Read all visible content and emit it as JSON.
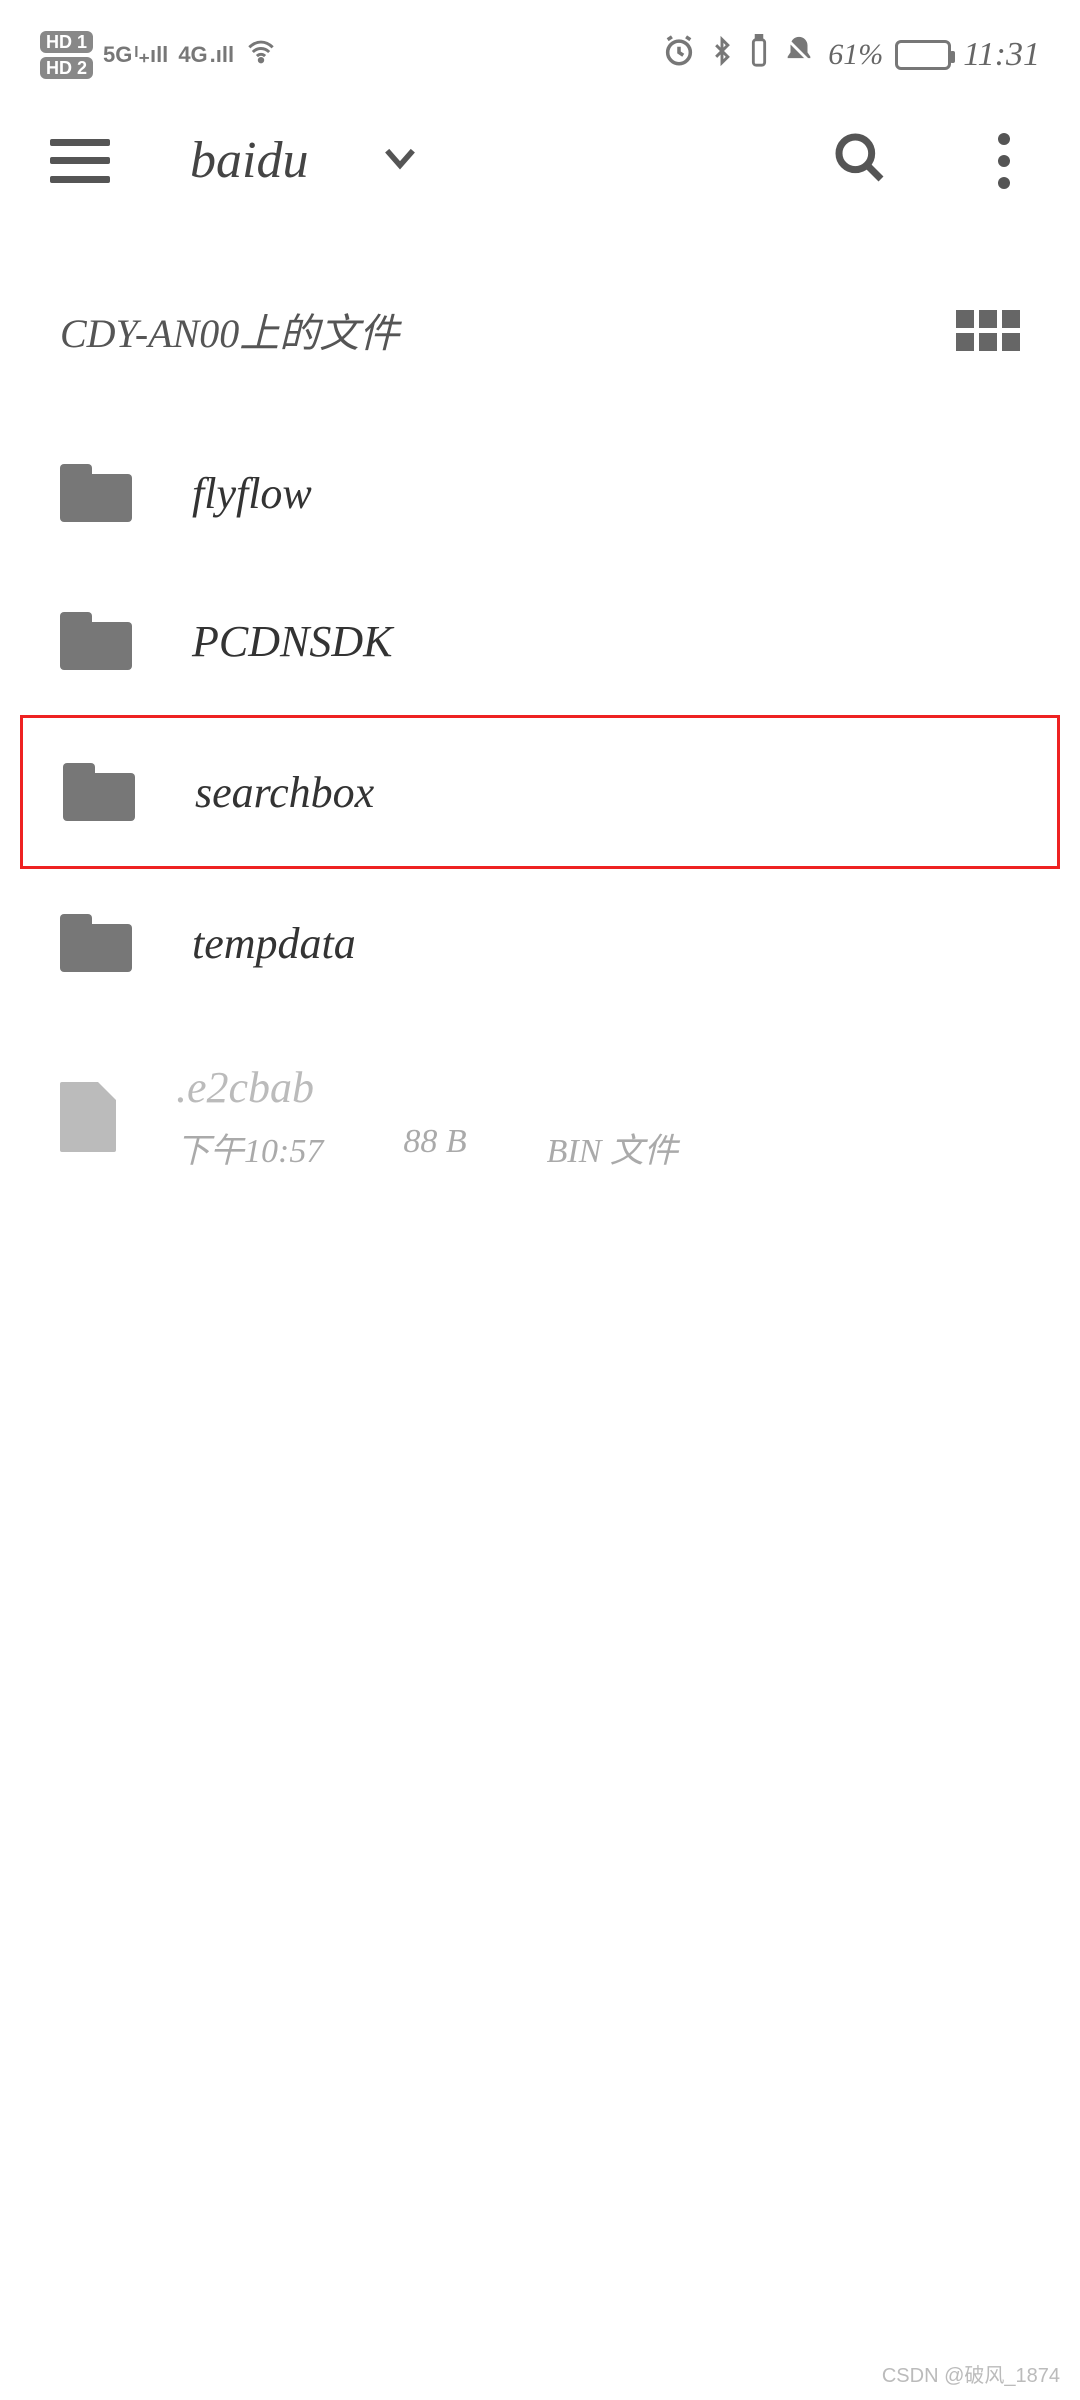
{
  "status_bar": {
    "hd1": "HD 1",
    "hd2": "HD 2",
    "net1": "5G",
    "net2": "4G",
    "battery_pct": "61%",
    "time": "11:31"
  },
  "app_bar": {
    "title": "baidu"
  },
  "subheader": {
    "title": "CDY-AN00上的文件"
  },
  "rows": [
    {
      "name": "flyflow",
      "type": "folder",
      "highlight": false
    },
    {
      "name": "PCDNSDK",
      "type": "folder",
      "highlight": false
    },
    {
      "name": "searchbox",
      "type": "folder",
      "highlight": true
    },
    {
      "name": "tempdata",
      "type": "folder",
      "highlight": false
    },
    {
      "name": ".e2cbab",
      "type": "file",
      "time": "下午10:57",
      "size": "88 B",
      "kind": "BIN 文件",
      "dim": true
    }
  ],
  "watermark": "CSDN @破风_1874"
}
